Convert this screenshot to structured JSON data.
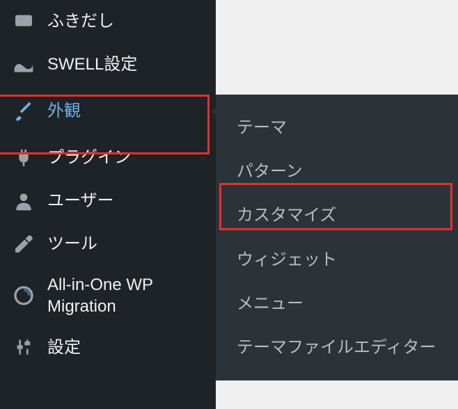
{
  "sidebar": {
    "items": [
      {
        "label": "ふきだし",
        "icon": "speech-bubble-icon"
      },
      {
        "label": "SWELL設定",
        "icon": "swell-icon"
      },
      {
        "label": "外観",
        "icon": "brush-icon"
      },
      {
        "label": "プラグイン",
        "icon": "plug-icon"
      },
      {
        "label": "ユーザー",
        "icon": "user-icon"
      },
      {
        "label": "ツール",
        "icon": "wrench-icon"
      },
      {
        "label": "All-in-One WP Migration",
        "icon": "migration-icon"
      },
      {
        "label": "設定",
        "icon": "settings-icon"
      }
    ]
  },
  "submenu": {
    "items": [
      {
        "label": "テーマ"
      },
      {
        "label": "パターン"
      },
      {
        "label": "カスタマイズ"
      },
      {
        "label": "ウィジェット"
      },
      {
        "label": "メニュー"
      },
      {
        "label": "テーマファイルエディター"
      }
    ]
  },
  "colors": {
    "sidebar_bg": "#1d2327",
    "submenu_bg": "#2c3338",
    "text": "#f0f0f1",
    "active": "#72aee6",
    "highlight": "#e62e2e"
  }
}
